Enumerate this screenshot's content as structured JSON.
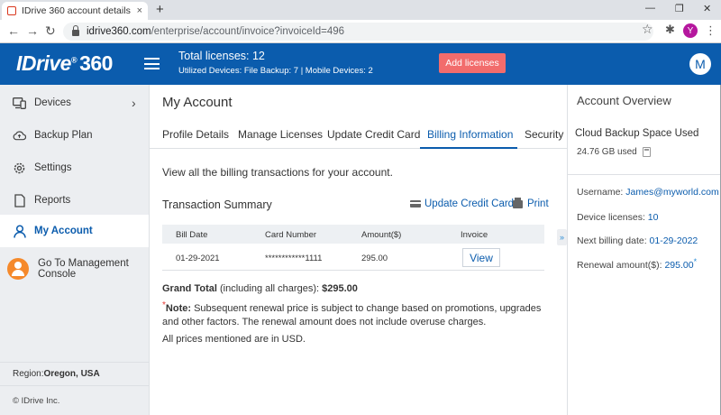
{
  "browser": {
    "tab_title": "IDrive 360 account details",
    "tab_close": "×",
    "new_tab": "+",
    "url_host": "idrive360.com",
    "url_path": "/enterprise/account/invoice?invoiceId=496",
    "profile_initial": "Y",
    "win_min": "—",
    "win_max": "❐",
    "win_close": "✕",
    "back": "←",
    "forward": "→",
    "reload": "↻",
    "star": "☆",
    "extensions": "✱",
    "menu": "⋮"
  },
  "header": {
    "logo_text": "IDrive",
    "logo_reg": "®",
    "logo_num": "360",
    "total_licenses": "Total licenses: 12",
    "utilized": "Utilized Devices: File Backup: 7 |  Mobile Devices: 2",
    "add_licenses": "Add licenses",
    "user_initial": "M"
  },
  "sidebar": {
    "items": [
      {
        "label": "Devices",
        "icon": "devices-icon"
      },
      {
        "label": "Backup Plan",
        "icon": "cloud-icon"
      },
      {
        "label": "Settings",
        "icon": "gear-icon"
      },
      {
        "label": "Reports",
        "icon": "report-icon"
      },
      {
        "label": "My Account",
        "icon": "user-icon"
      }
    ],
    "chevron": "›",
    "management": "Go To Management Console",
    "region_label": "Region: ",
    "region_value": "Oregon, USA",
    "copyright": "© IDrive Inc."
  },
  "main": {
    "title": "My Account",
    "tabs": [
      "Profile Details",
      "Manage Licenses",
      "Update Credit Card",
      "Billing Information",
      "Security"
    ],
    "active_tab": "Billing Information",
    "description": "View all the billing transactions for your account.",
    "summary_title": "Transaction Summary",
    "update_cc": "Update Credit Card",
    "print": "Print",
    "table": {
      "headers": [
        "Bill Date",
        "Card Number",
        "Amount($)",
        "Invoice"
      ],
      "rows": [
        {
          "date": "01-29-2021",
          "card": "************1111",
          "amount": "295.00",
          "invoice": "View"
        }
      ]
    },
    "grand_label": "Grand Total",
    "grand_mid": " (including all charges): ",
    "grand_value": "$295.00",
    "note_label": "Note:",
    "note_text": " Subsequent renewal price is subject to change based on promotions, upgrades and other factors. The renewal amount does not include overuse charges.",
    "usd_note": "All prices mentioned are in USD."
  },
  "overview": {
    "title": "Account Overview",
    "space_title": "Cloud  Backup Space Used",
    "space_used": "24.76 GB used",
    "username_label": "Username: ",
    "username": "James@myworld.com",
    "licenses_label": "Device licenses: ",
    "licenses": "10",
    "billing_label": "Next billing date: ",
    "billing_date": "01-29-2022",
    "renewal_label": "Renewal amount($): ",
    "renewal": "295.00",
    "asterisk": "*"
  },
  "colors": {
    "brand": "#0b5cad",
    "accent": "#f26c6c",
    "orange": "#f5892b"
  }
}
